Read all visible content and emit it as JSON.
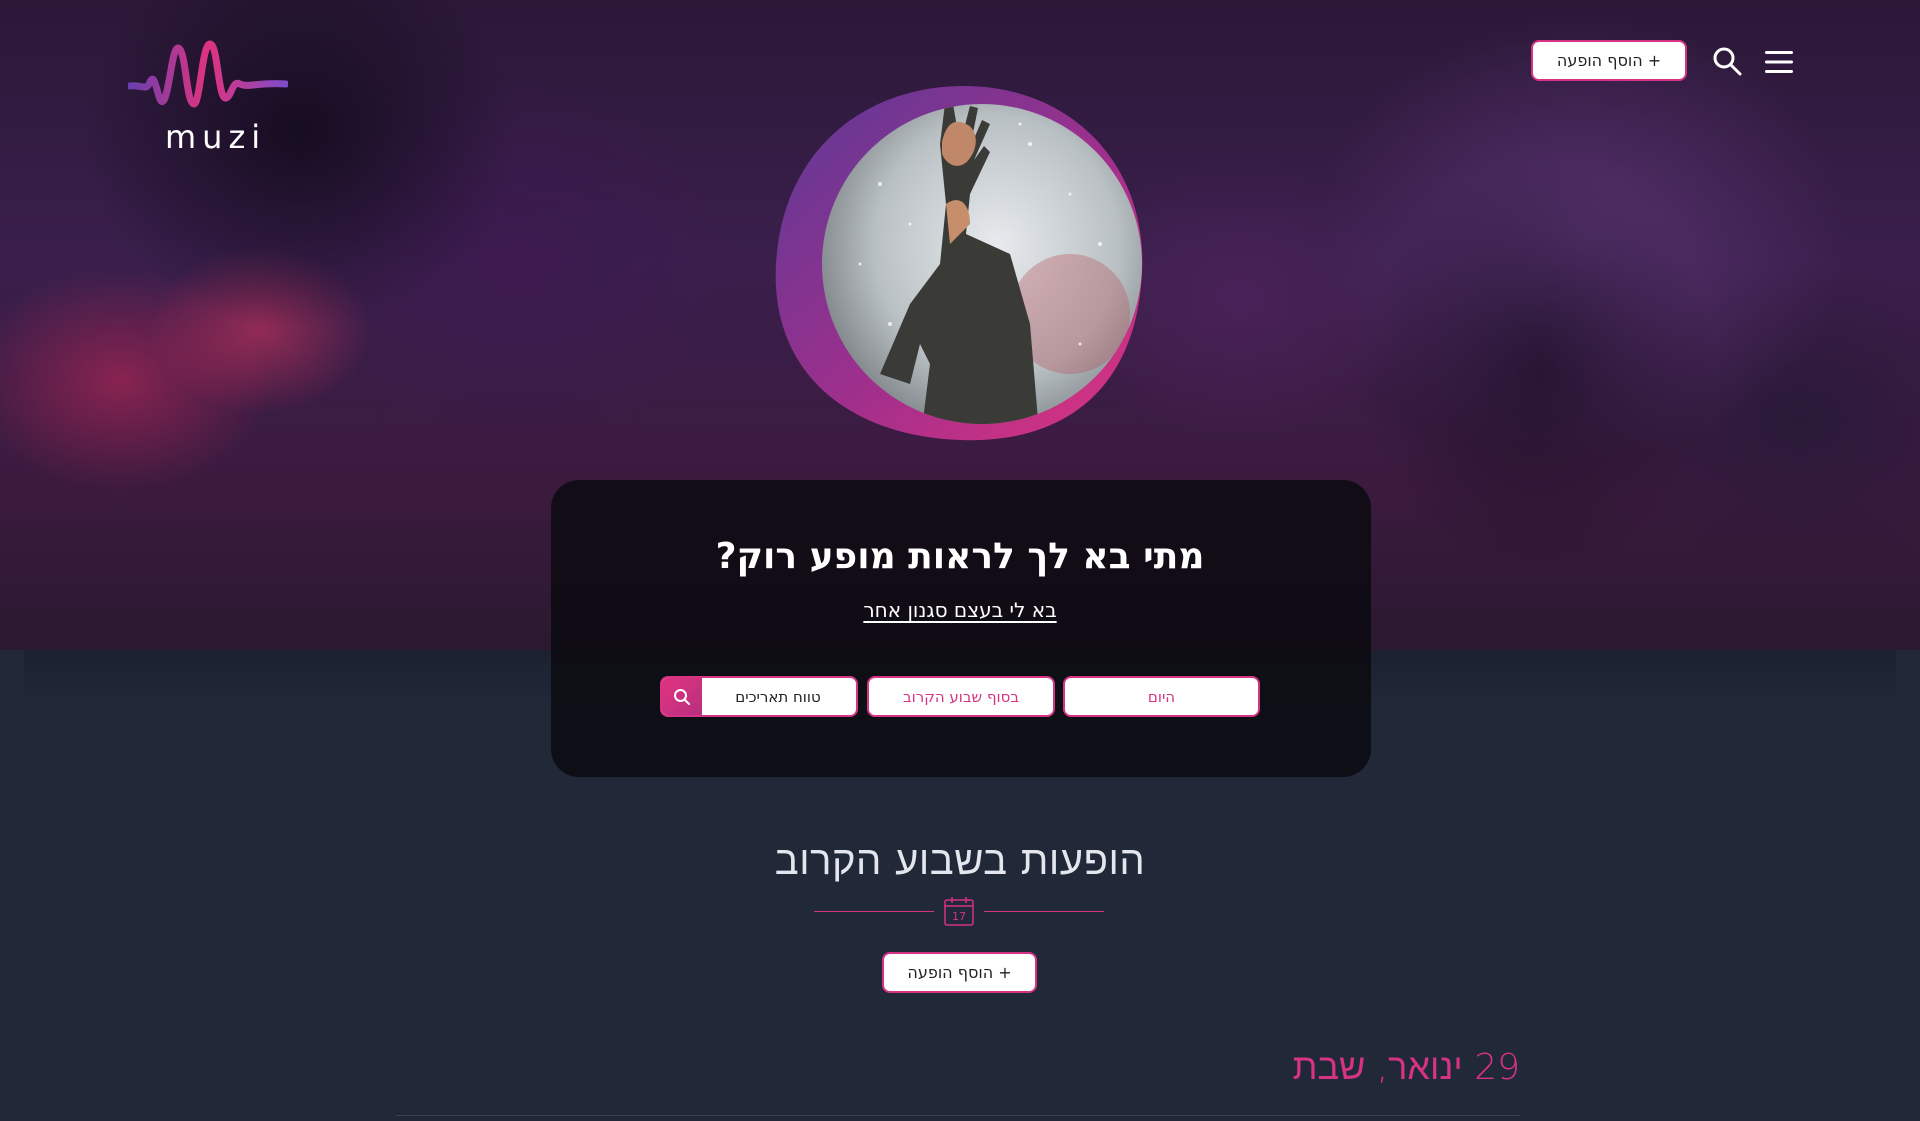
{
  "brand": {
    "name": "muzi",
    "accent": "#d63384",
    "accent2": "#5b3a99"
  },
  "header": {
    "add_event_label": "+ הוסף הופעה",
    "search_icon": "search-icon",
    "menu_icon": "hamburger-menu-icon"
  },
  "hero": {
    "image": "singer-with-microphone-raised-hand"
  },
  "search_panel": {
    "title": "מתי בא לך לראות מופע רוק?",
    "alt_genre_link": "בא לי בעצם סגנון אחר",
    "filters": {
      "today": "היום",
      "weekend": "בסוף שבוע הקרוב",
      "date_range_placeholder": "טווח תאריכים"
    }
  },
  "events_section": {
    "title": "הופעות בשבוע הקרוב",
    "calendar_day": "17",
    "add_event_label": "+ הוסף הופעה",
    "date_heading": "29 ינואר, שבת"
  }
}
